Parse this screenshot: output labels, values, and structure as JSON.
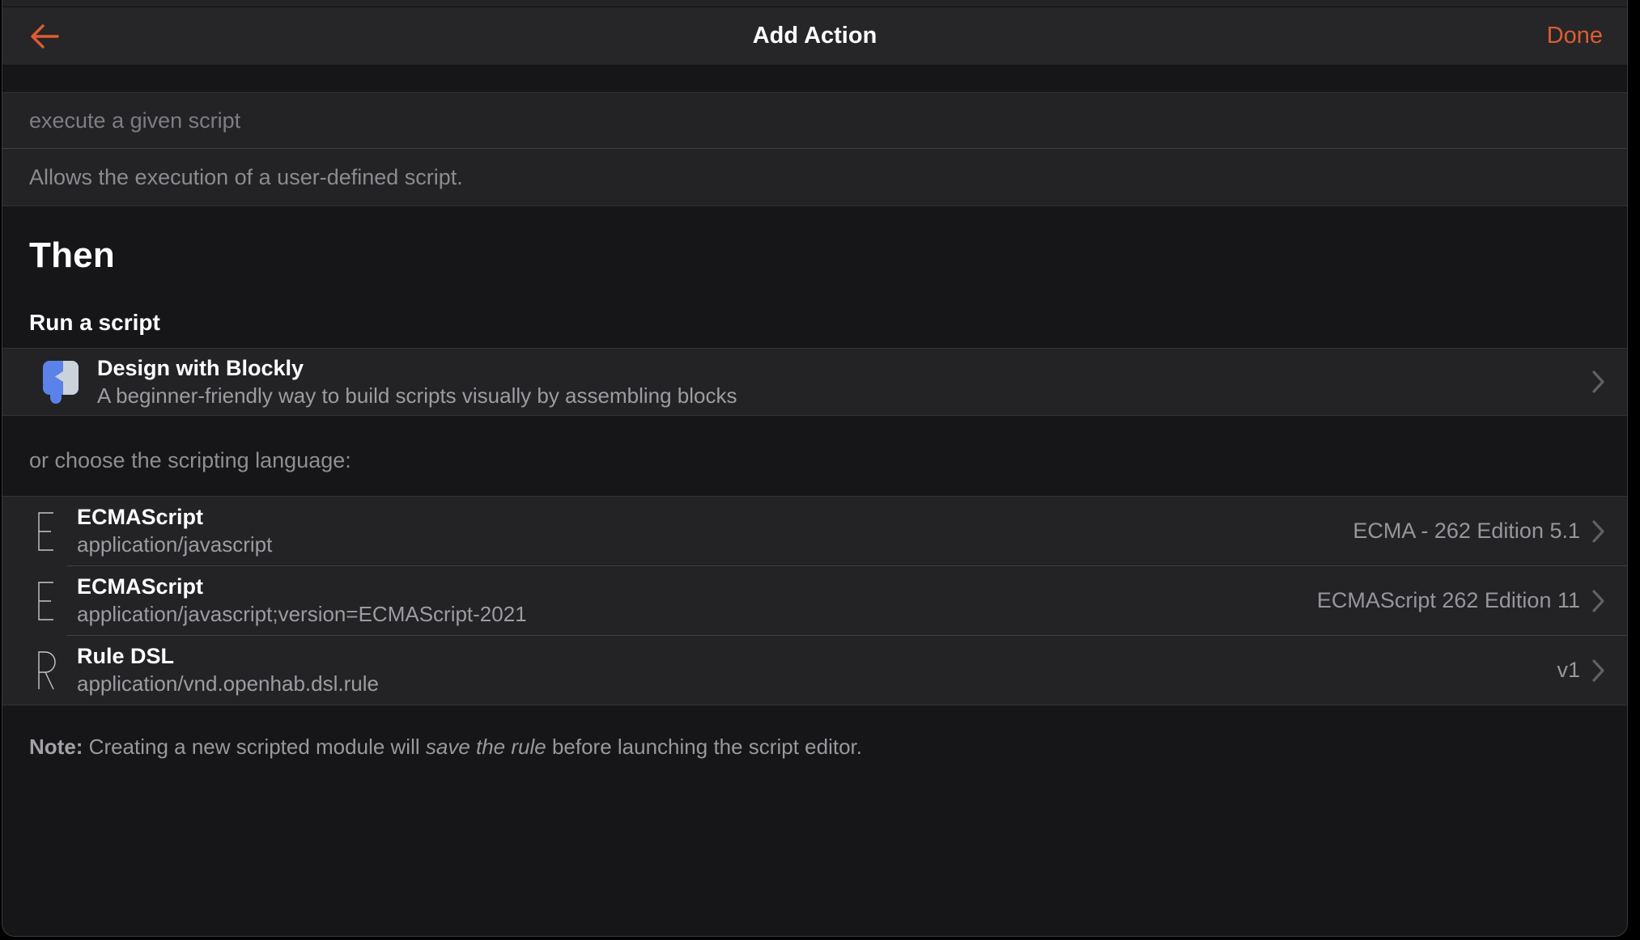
{
  "accent_color": "#dd5c33",
  "navbar": {
    "title": "Add Action",
    "back_icon": "arrow-left",
    "done_label": "Done"
  },
  "module": {
    "description_value": "execute a given script",
    "help_text": "Allows the execution of a user-defined script."
  },
  "section": {
    "then_heading": "Then",
    "subheading": "Run a script"
  },
  "blockly_item": {
    "icon": "blockly-logo",
    "icon_blue": "#5b82e8",
    "icon_gray": "#ccd2dc",
    "title": "Design with Blockly",
    "subtitle": "A beginner-friendly way to build scripts visually by assembling blocks"
  },
  "choose_label": "or choose the scripting language:",
  "languages": [
    {
      "initial": "E",
      "title": "ECMAScript",
      "subtitle": "application/javascript",
      "version": "ECMA - 262 Edition 5.1"
    },
    {
      "initial": "E",
      "title": "ECMAScript",
      "subtitle": "application/javascript;version=ECMAScript-2021",
      "version": "ECMAScript 262 Edition 11"
    },
    {
      "initial": "R",
      "title": "Rule DSL",
      "subtitle": "application/vnd.openhab.dsl.rule",
      "version": "v1"
    }
  ],
  "note": {
    "label": "Note:",
    "before_italic": " Creating a new scripted module will ",
    "italic": "save the rule",
    "after_italic": " before launching the script editor."
  }
}
